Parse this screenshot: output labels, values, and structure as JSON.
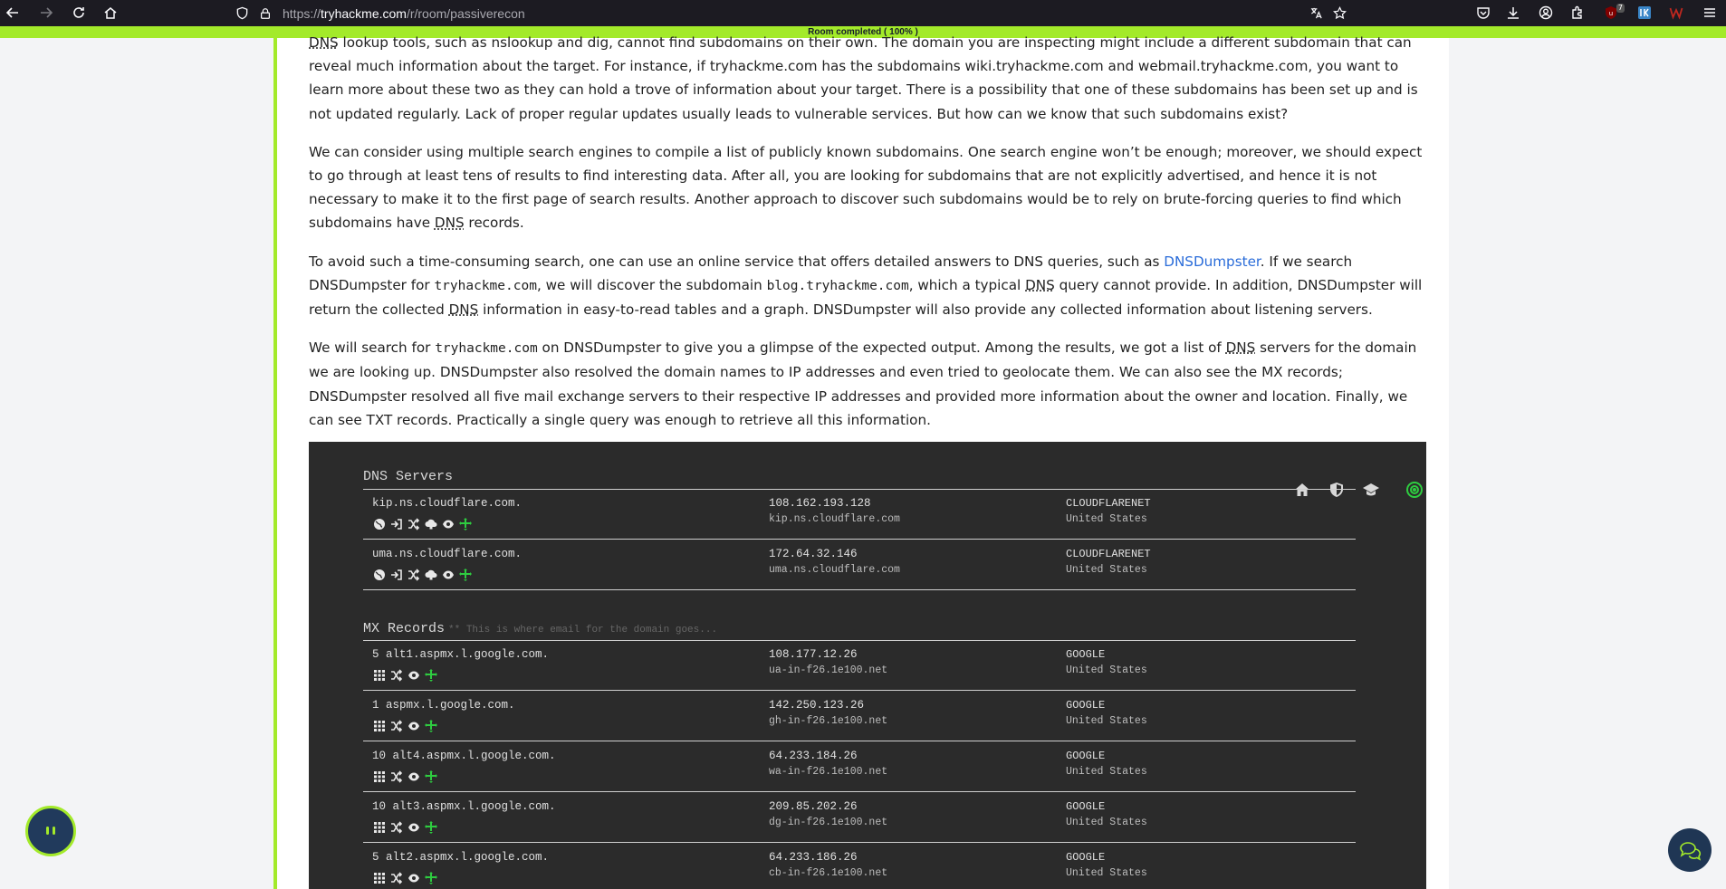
{
  "browser": {
    "url_prefix": "https://",
    "url_host": "tryhackme.com",
    "url_path": "/r/room/passiverecon",
    "ext_badge": "7"
  },
  "progress": {
    "label": "Room completed ( 100% )",
    "percent": 100
  },
  "article": {
    "p0": {
      "abbr_dns": "DNS",
      "text": " lookup tools, such as nslookup and dig, cannot find subdomains on their own. The domain you are inspecting might include a different subdomain that can reveal much information about the target. For instance, if tryhackme.com has the subdomains wiki.tryhackme.com and webmail.tryhackme.com, you want to learn more about these two as they can hold a trove of information about your target. There is a possibility that one of these subdomains has been set up and is not updated regularly. Lack of proper regular updates usually leads to vulnerable services. But how can we know that such subdomains exist?"
    },
    "p1": {
      "text_a": "We can consider using multiple search engines to compile a list of publicly known subdomains. One search engine won’t be enough; moreover, we should expect to go through at least tens of results to find interesting data. After all, you are looking for subdomains that are not explicitly advertised, and hence it is not necessary to make it to the first page of search results. Another approach to discover such subdomains would be to rely on brute-forcing queries to find which subdomains have ",
      "abbr": "DNS",
      "text_b": " records."
    },
    "p2": {
      "text_a": "To avoid such a time-consuming search, one can use an online service that offers detailed answers to DNS queries, such as ",
      "link": "DNSDumpster",
      "text_b": ". If we search DNSDumpster for ",
      "code1": "tryhackme.com",
      "text_c": ", we will discover the subdomain ",
      "code2": "blog.tryhackme.com",
      "text_d": ", which a typical ",
      "abbr1": "DNS",
      "text_e": " query cannot provide. In addition, DNSDumpster will return the collected ",
      "abbr2": "DNS",
      "text_f": " information in easy-to-read tables and a graph. DNSDumpster will also provide any collected information about listening servers."
    },
    "p3": {
      "text_a": "We will search for ",
      "code": "tryhackme.com",
      "text_b": " on DNSDumpster to give you a glimpse of the expected output. Among the results, we got a list of ",
      "abbr": "DNS",
      "text_c": " servers for the domain we are looking up. DNSDumpster also resolved the domain names to IP addresses and even tried to geolocate them. We can also see the MX records; DNSDumpster resolved all five mail exchange servers to their respective IP addresses and provided more information about the owner and location. Finally, we can see TXT records. Practically a single query was enough to retrieve all this information."
    }
  },
  "dump": {
    "dns_title": "DNS Servers",
    "mx_title": "MX Records",
    "mx_sub": "** This is where email for the domain goes...",
    "dns_rows": [
      {
        "host": "kip.ns.cloudflare.com.",
        "ip": "108.162.193.128",
        "rdns": "kip.ns.cloudflare.com",
        "asn": "CLOUDFLARENET",
        "country": "United States"
      },
      {
        "host": "uma.ns.cloudflare.com.",
        "ip": "172.64.32.146",
        "rdns": "uma.ns.cloudflare.com",
        "asn": "CLOUDFLARENET",
        "country": "United States"
      }
    ],
    "mx_rows": [
      {
        "host": "5 alt1.aspmx.l.google.com.",
        "ip": "108.177.12.26",
        "rdns": "ua-in-f26.1e100.net",
        "asn": "GOOGLE",
        "country": "United States"
      },
      {
        "host": "1 aspmx.l.google.com.",
        "ip": "142.250.123.26",
        "rdns": "gh-in-f26.1e100.net",
        "asn": "GOOGLE",
        "country": "United States"
      },
      {
        "host": "10 alt4.aspmx.l.google.com.",
        "ip": "64.233.184.26",
        "rdns": "wa-in-f26.1e100.net",
        "asn": "GOOGLE",
        "country": "United States"
      },
      {
        "host": "10 alt3.aspmx.l.google.com.",
        "ip": "209.85.202.26",
        "rdns": "dg-in-f26.1e100.net",
        "asn": "GOOGLE",
        "country": "United States"
      },
      {
        "host": "5 alt2.aspmx.l.google.com.",
        "ip": "64.233.186.26",
        "rdns": "cb-in-f26.1e100.net",
        "asn": "GOOGLE",
        "country": "United States"
      }
    ]
  },
  "colors": {
    "accent": "#a3ea2a",
    "link": "#2a6cd9",
    "dump_bg": "#2b2b2b",
    "toolbar_bg": "#1c1b22"
  }
}
